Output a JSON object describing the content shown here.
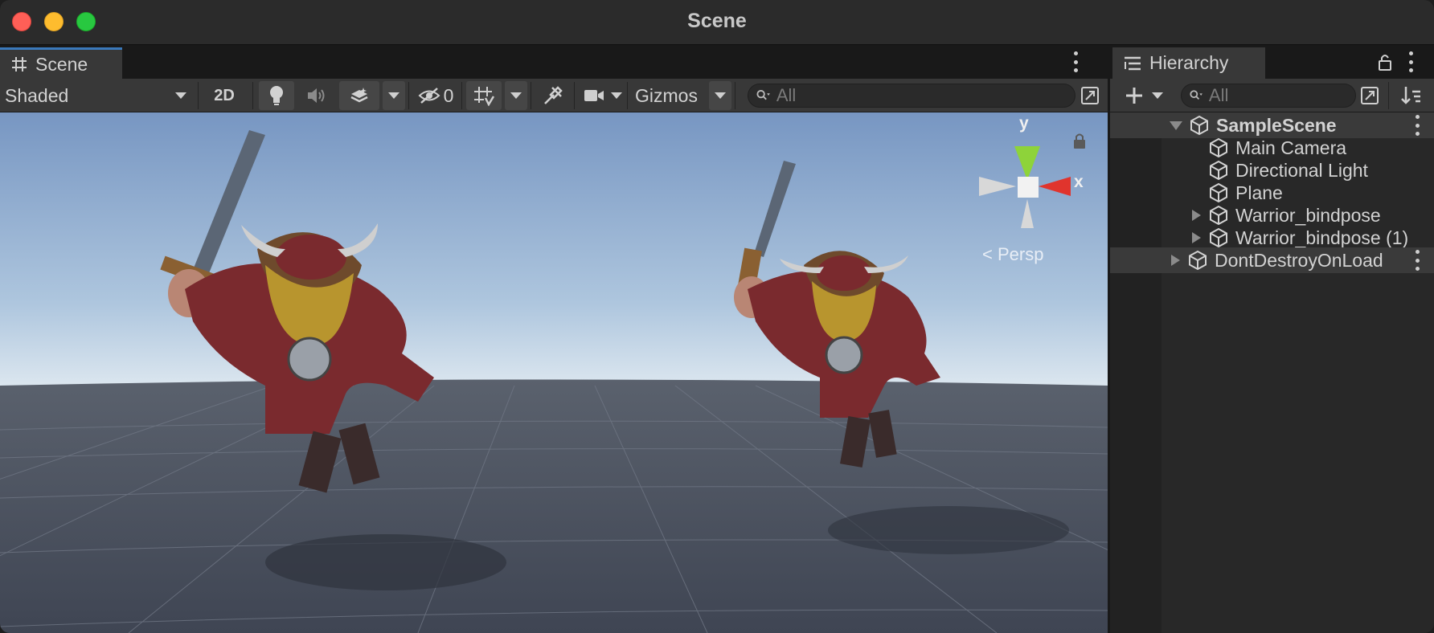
{
  "window": {
    "title": "Scene"
  },
  "scene_tab": {
    "label": "Scene"
  },
  "scene_toolbar": {
    "shading_mode": "Shaded",
    "mode_2d": "2D",
    "hidden_count": "0",
    "gizmos_label": "Gizmos",
    "search_placeholder": "All"
  },
  "viewport": {
    "gizmo_axis_y": "y",
    "gizmo_axis_x": "x",
    "projection_label": "< Persp"
  },
  "hierarchy": {
    "tab_label": "Hierarchy",
    "search_placeholder": "All",
    "scene_name": "SampleScene",
    "items": [
      {
        "label": "Main Camera",
        "expandable": false
      },
      {
        "label": "Directional Light",
        "expandable": false
      },
      {
        "label": "Plane",
        "expandable": false
      },
      {
        "label": "Warrior_bindpose",
        "expandable": true
      },
      {
        "label": "Warrior_bindpose (1)",
        "expandable": true
      }
    ],
    "dont_destroy": "DontDestroyOnLoad"
  },
  "colors": {
    "accent_tab": "#3a79bb",
    "gizmo_y": "#8ed33a",
    "gizmo_x": "#e0342d",
    "sky_top": "#7f9ec9",
    "ground": "#4a5160"
  }
}
